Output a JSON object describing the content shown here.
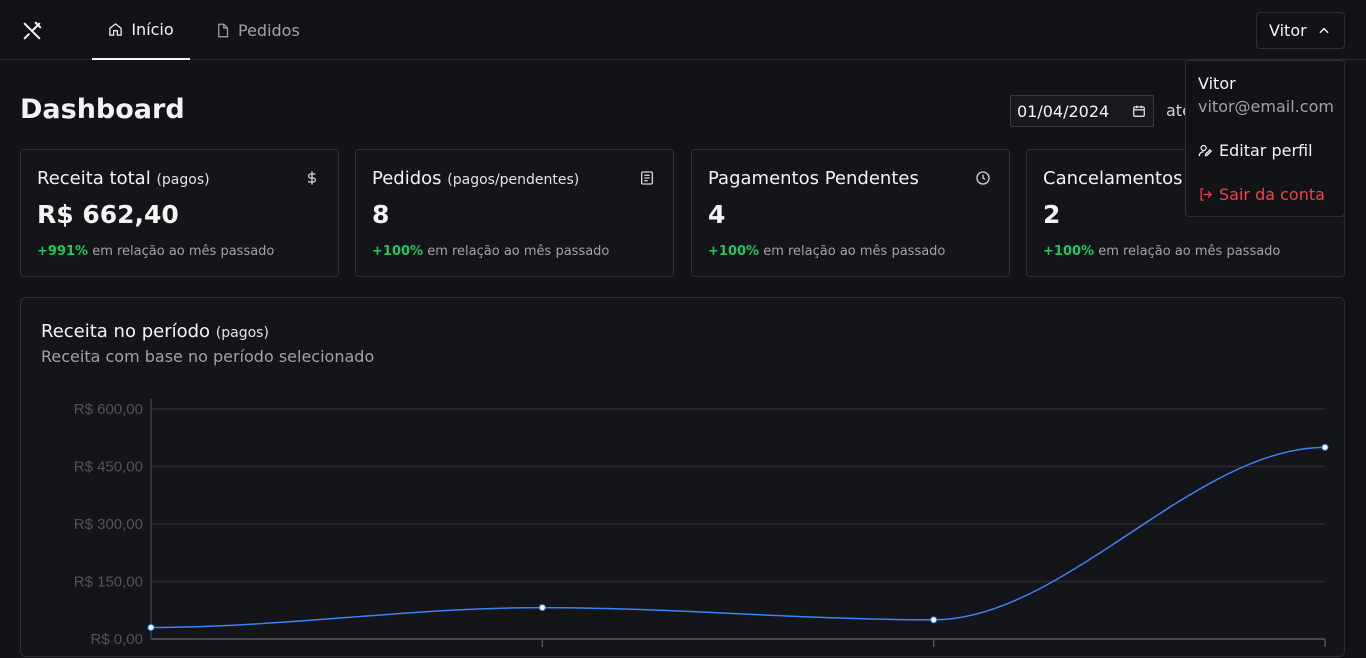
{
  "nav": {
    "logo_icon": "utensils-crossed-icon",
    "tabs": [
      {
        "label": "Início",
        "icon": "home-icon",
        "active": true
      },
      {
        "label": "Pedidos",
        "icon": "file-icon",
        "active": false
      }
    ],
    "user_button": {
      "label": "Vitor",
      "icon": "chevron-up-icon"
    }
  },
  "page": {
    "title": "Dashboard",
    "date_from": "01/04/2024",
    "date_separator": "até"
  },
  "cards": [
    {
      "title": "Receita total",
      "subtitle": "(pagos)",
      "icon": "dollar-sign-icon",
      "value": "R$ 662,40",
      "change": "+991%",
      "change_text": "em relação ao mês passado"
    },
    {
      "title": "Pedidos",
      "subtitle": "(pagos/pendentes)",
      "icon": "receipt-icon",
      "value": "8",
      "change": "+100%",
      "change_text": "em relação ao mês passado"
    },
    {
      "title": "Pagamentos Pendentes",
      "subtitle": "",
      "icon": "clock-icon",
      "value": "4",
      "change": "+100%",
      "change_text": "em relação ao mês passado"
    },
    {
      "title": "Cancelamentos",
      "subtitle": "",
      "icon": "",
      "value": "2",
      "change": "+100%",
      "change_text": "em relação ao mês passado"
    }
  ],
  "chart_section": {
    "title": "Receita no período",
    "subtitle": "(pagos)",
    "description": "Receita com base no período selecionado"
  },
  "chart_data": {
    "type": "line",
    "title": "",
    "xlabel": "",
    "ylabel": "",
    "y_tick_labels": [
      "R$ 600,00",
      "R$ 450,00",
      "R$ 300,00",
      "R$ 150,00",
      "R$ 0,00"
    ],
    "y_ticks": [
      600,
      450,
      300,
      150,
      0
    ],
    "ylim": [
      0,
      600
    ],
    "x_points": 4,
    "values": [
      30,
      82,
      50,
      500
    ],
    "line_color": "#3b82f6",
    "grid": true
  },
  "dropdown": {
    "name": "Vitor",
    "email": "vitor@email.com",
    "edit_label": "Editar perfil",
    "edit_icon": "user-pen-icon",
    "logout_label": "Sair da conta",
    "logout_icon": "log-out-icon",
    "logout_color": "#ef4444"
  },
  "colors": {
    "background": "#121316",
    "positive": "#22c55e",
    "border": "#2e2f35"
  }
}
